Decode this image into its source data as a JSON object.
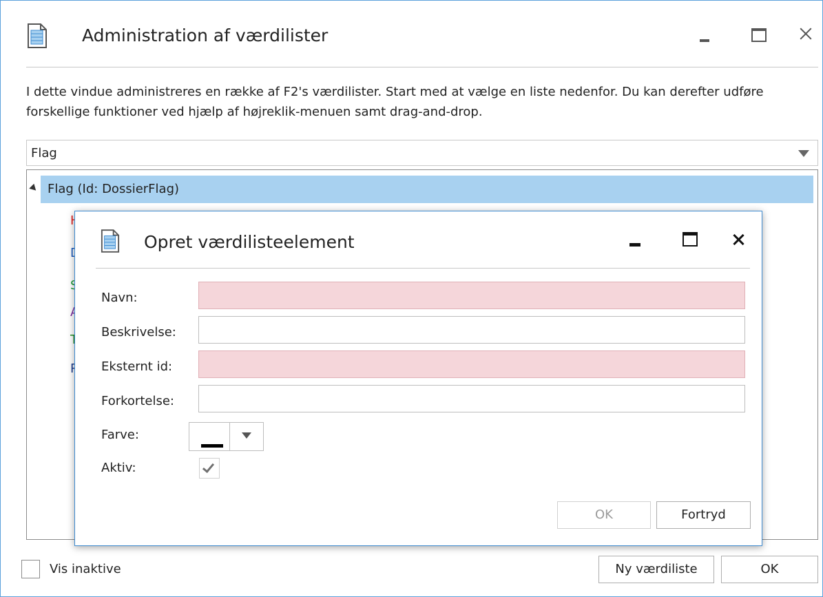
{
  "main_window": {
    "title": "Administration af værdilister",
    "icon": "document-icon",
    "description": "I dette vindue administreres en række af F2's værdilister. Start med at vælge en liste nedenfor. Du kan derefter udføre forskellige funktioner ved hjælp af højreklik-menuen samt drag-and-drop.",
    "list_select": {
      "value": "Flag"
    },
    "tree": {
      "root_label": "Flag (Id: DossierFlag)",
      "items": [
        {
          "label": "Ha",
          "color": "#e02020"
        },
        {
          "label": "De",
          "color": "#1f5fbf"
        },
        {
          "label": "Sk",
          "color": "#1a9a3a"
        },
        {
          "label": "Af",
          "color": "#7a2ea0"
        },
        {
          "label": "Til",
          "color": "#1a8a1a"
        },
        {
          "label": "Re",
          "color": "#1f3f8f"
        }
      ]
    },
    "show_inactive": {
      "label": "Vis inaktive",
      "checked": false
    },
    "buttons": {
      "new_list": "Ny værdiliste",
      "ok": "OK"
    }
  },
  "dialog": {
    "title": "Opret værdilisteelement",
    "icon": "document-icon",
    "fields": {
      "name": {
        "label": "Navn:",
        "value": ""
      },
      "description": {
        "label": "Beskrivelse:",
        "value": ""
      },
      "external_id": {
        "label": "Eksternt id:",
        "value": ""
      },
      "abbreviation": {
        "label": "Forkortelse:",
        "value": ""
      },
      "color": {
        "label": "Farve:",
        "value": "#000000"
      },
      "active": {
        "label": "Aktiv:",
        "checked": true
      }
    },
    "buttons": {
      "ok": "OK",
      "cancel": "Fortryd"
    }
  },
  "colors": {
    "accent_border": "#3c8ad0",
    "selection": "#a8d1f0",
    "required_field": "#f5d6da"
  }
}
